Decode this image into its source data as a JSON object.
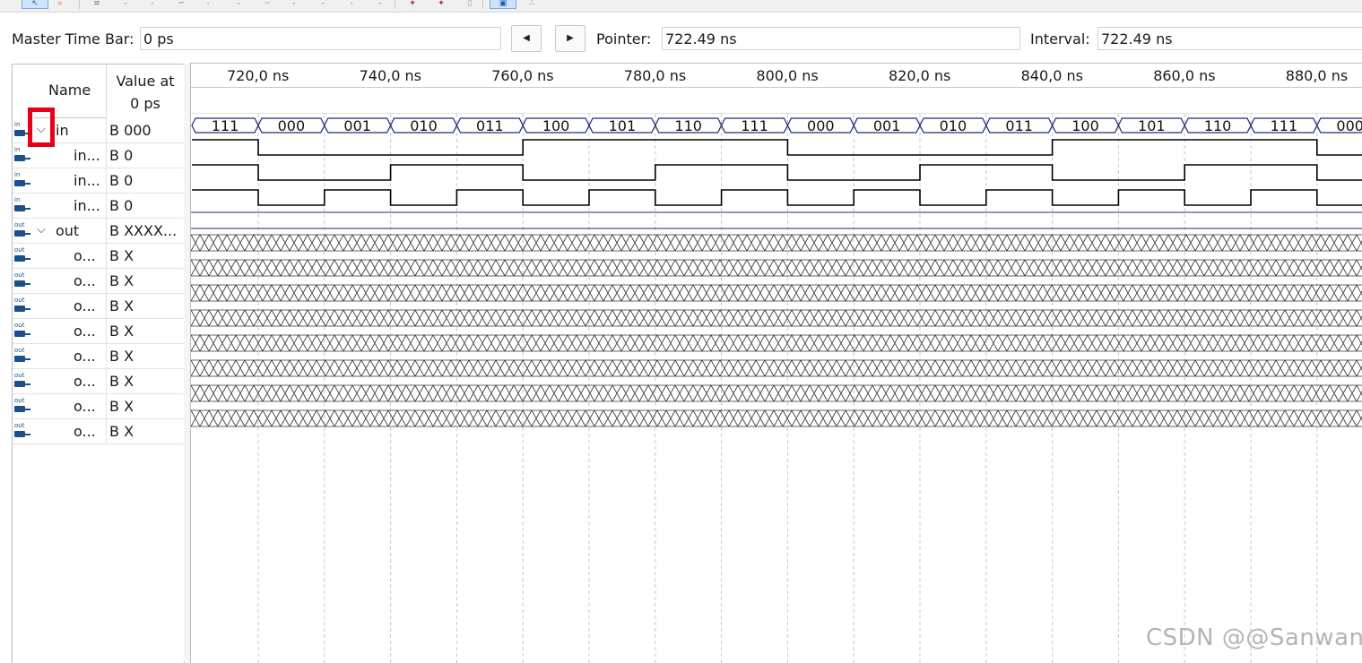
{
  "toolbar": {
    "tools": [
      "select-tool-icon",
      "zoom-tool-icon",
      "text-tool-icon",
      "value-zero-icon",
      "value-one-icon",
      "value-z-icon",
      "invert-icon",
      "count-value-icon",
      "clock-icon",
      "random-icon",
      "overwrite-icon",
      "arbitrary-value-icon",
      "weak-high-icon",
      "weak-low-icon",
      "grid-icon",
      "snap-to-grid-icon",
      "sort-icon"
    ]
  },
  "timebar": {
    "master_label": "Master Time Bar:",
    "master_value": "0 ps",
    "pointer_label": "Pointer:",
    "pointer_value": "722.49 ns",
    "interval_label": "Interval:",
    "interval_value": "722.49 ns"
  },
  "nodes": {
    "header_name": "Name",
    "header_value": "Value at\n0 ps",
    "rows": [
      {
        "dir": "in",
        "name": "in",
        "value": "B 000",
        "group": true
      },
      {
        "dir": "in",
        "name": "in...",
        "value": "B 0",
        "group": false
      },
      {
        "dir": "in",
        "name": "in...",
        "value": "B 0",
        "group": false
      },
      {
        "dir": "in",
        "name": "in...",
        "value": "B 0",
        "group": false
      },
      {
        "dir": "out",
        "name": "out",
        "value": "B XXXX...",
        "group": true
      },
      {
        "dir": "out",
        "name": "o...",
        "value": "B X",
        "group": false
      },
      {
        "dir": "out",
        "name": "o...",
        "value": "B X",
        "group": false
      },
      {
        "dir": "out",
        "name": "o...",
        "value": "B X",
        "group": false
      },
      {
        "dir": "out",
        "name": "o...",
        "value": "B X",
        "group": false
      },
      {
        "dir": "out",
        "name": "o...",
        "value": "B X",
        "group": false
      },
      {
        "dir": "out",
        "name": "o...",
        "value": "B X",
        "group": false
      },
      {
        "dir": "out",
        "name": "o...",
        "value": "B X",
        "group": false
      },
      {
        "dir": "out",
        "name": "o...",
        "value": "B X",
        "group": false
      }
    ]
  },
  "waveform": {
    "time_labels": [
      "720,0 ns",
      "740,0 ns",
      "760,0 ns",
      "780,0 ns",
      "800,0 ns",
      "820,0 ns",
      "840,0 ns",
      "860,0 ns",
      "880,0 ns"
    ],
    "bus_values": [
      "111",
      "000",
      "001",
      "010",
      "011",
      "100",
      "101",
      "110",
      "111",
      "000",
      "001",
      "010",
      "011",
      "100",
      "101",
      "110",
      "111",
      "000"
    ],
    "bit_levels": {
      "in2": [
        1,
        0,
        0,
        0,
        0,
        1,
        1,
        1,
        1,
        0,
        0,
        0,
        0,
        1,
        1,
        1,
        1,
        0
      ],
      "in1": [
        1,
        0,
        0,
        1,
        1,
        0,
        0,
        1,
        1,
        0,
        0,
        1,
        1,
        0,
        0,
        1,
        1,
        0
      ],
      "in0": [
        1,
        0,
        1,
        0,
        1,
        0,
        1,
        0,
        1,
        0,
        1,
        0,
        1,
        0,
        1,
        0,
        1,
        0
      ]
    },
    "unknown_rows": 8,
    "colors": {
      "bus": "#1c2a78",
      "signal": "#000000",
      "grid": "#c8c8c8",
      "highlight": "#e4001b"
    }
  },
  "watermark": "CSDN @@Sanwan"
}
